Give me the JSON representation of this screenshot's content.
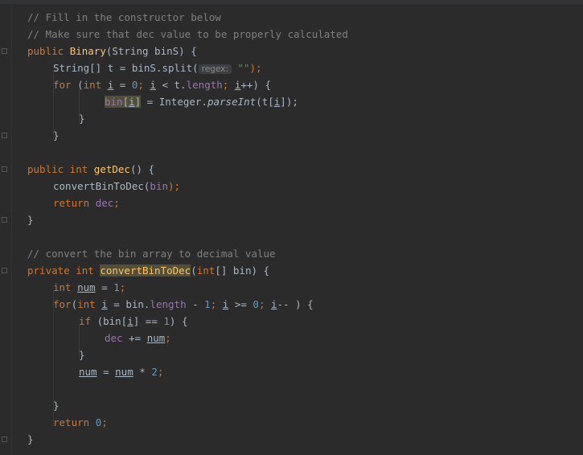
{
  "editor": {
    "lines": [
      {
        "row": 0,
        "indent": 0,
        "tokens": [
          {
            "t": "// Fill in the constructor below",
            "c": "cmt"
          }
        ]
      },
      {
        "row": 1,
        "indent": 0,
        "tokens": [
          {
            "t": "// Make sure that dec value to be properly calculated",
            "c": "cmt"
          }
        ]
      },
      {
        "row": 2,
        "indent": 0,
        "tokens": [
          {
            "t": "public ",
            "c": "kw"
          },
          {
            "t": "Binary",
            "c": "fn"
          },
          {
            "t": "(String binS) {",
            "c": ""
          }
        ]
      },
      {
        "row": 3,
        "indent": 1,
        "tokens": [
          {
            "t": "String[] t = binS.split(",
            "c": ""
          },
          {
            "t": "regex:",
            "c": "hint"
          },
          {
            "t": " ",
            "c": ""
          },
          {
            "t": "\"\"",
            "c": "str"
          },
          {
            "t": ");",
            "c": "kw"
          }
        ]
      },
      {
        "row": 4,
        "indent": 1,
        "tokens": [
          {
            "t": "for ",
            "c": "kw"
          },
          {
            "t": "(",
            "c": ""
          },
          {
            "t": "int ",
            "c": "kw"
          },
          {
            "t": "i",
            "c": "ul"
          },
          {
            "t": " = ",
            "c": ""
          },
          {
            "t": "0",
            "c": "num"
          },
          {
            "t": "; ",
            "c": "kw"
          },
          {
            "t": "i",
            "c": "ul"
          },
          {
            "t": " < t.",
            "c": ""
          },
          {
            "t": "length",
            "c": "fld"
          },
          {
            "t": "; ",
            "c": "kw"
          },
          {
            "t": "i",
            "c": "ul"
          },
          {
            "t": "++) {",
            "c": ""
          }
        ]
      },
      {
        "row": 5,
        "indent": 3,
        "tokens": [
          {
            "t": "bin",
            "c": "fld hl2"
          },
          {
            "t": "[",
            "c": "hl2"
          },
          {
            "t": "i",
            "c": "ul hl2"
          },
          {
            "t": "]",
            "c": "hl2"
          },
          {
            "t": " = Integer.",
            "c": ""
          },
          {
            "t": "parseInt",
            "c": "ital"
          },
          {
            "t": "(t[",
            "c": ""
          },
          {
            "t": "i",
            "c": "ul"
          },
          {
            "t": "]);",
            "c": ""
          }
        ]
      },
      {
        "row": 6,
        "indent": 2,
        "tokens": [
          {
            "t": "}",
            "c": ""
          }
        ]
      },
      {
        "row": 7,
        "indent": 1,
        "tokens": [
          {
            "t": "}",
            "c": ""
          }
        ]
      },
      {
        "row": 9,
        "indent": 0,
        "tokens": [
          {
            "t": "public int ",
            "c": "kw"
          },
          {
            "t": "getDec",
            "c": "fn"
          },
          {
            "t": "() {",
            "c": ""
          }
        ]
      },
      {
        "row": 10,
        "indent": 1,
        "tokens": [
          {
            "t": "convertBinToDec(",
            "c": ""
          },
          {
            "t": "bin",
            "c": "fld"
          },
          {
            "t": ");",
            "c": "kw"
          }
        ]
      },
      {
        "row": 11,
        "indent": 1,
        "tokens": [
          {
            "t": "return ",
            "c": "kw"
          },
          {
            "t": "dec",
            "c": "fld"
          },
          {
            "t": ";",
            "c": "kw"
          }
        ]
      },
      {
        "row": 12,
        "indent": 0,
        "tokens": [
          {
            "t": "}",
            "c": ""
          }
        ]
      },
      {
        "row": 14,
        "indent": 0,
        "tokens": [
          {
            "t": "// convert the bin array to decimal value",
            "c": "cmt"
          }
        ]
      },
      {
        "row": 15,
        "indent": 0,
        "tokens": [
          {
            "t": "private int ",
            "c": "kw"
          },
          {
            "t": "convertBinToDec",
            "c": "fn hl2"
          },
          {
            "t": "(",
            "c": ""
          },
          {
            "t": "int",
            "c": "kw"
          },
          {
            "t": "[] bin) {",
            "c": ""
          }
        ]
      },
      {
        "row": 16,
        "indent": 1,
        "tokens": [
          {
            "t": "int ",
            "c": "kw"
          },
          {
            "t": "num",
            "c": "ul"
          },
          {
            "t": " = ",
            "c": ""
          },
          {
            "t": "1",
            "c": "num"
          },
          {
            "t": ";",
            "c": "kw"
          }
        ]
      },
      {
        "row": 17,
        "indent": 1,
        "tokens": [
          {
            "t": "for",
            "c": "kw"
          },
          {
            "t": "(",
            "c": ""
          },
          {
            "t": "int ",
            "c": "kw"
          },
          {
            "t": "i",
            "c": "ul"
          },
          {
            "t": " = bin.",
            "c": ""
          },
          {
            "t": "length",
            "c": "fld"
          },
          {
            "t": " - ",
            "c": ""
          },
          {
            "t": "1",
            "c": "num"
          },
          {
            "t": "; ",
            "c": "kw"
          },
          {
            "t": "i",
            "c": "ul"
          },
          {
            "t": " >= ",
            "c": ""
          },
          {
            "t": "0",
            "c": "num"
          },
          {
            "t": "; ",
            "c": "kw"
          },
          {
            "t": "i",
            "c": "ul"
          },
          {
            "t": "-- ) {",
            "c": ""
          }
        ]
      },
      {
        "row": 18,
        "indent": 2,
        "tokens": [
          {
            "t": "if ",
            "c": "kw"
          },
          {
            "t": "(bin[",
            "c": ""
          },
          {
            "t": "i",
            "c": "ul"
          },
          {
            "t": "] == ",
            "c": ""
          },
          {
            "t": "1",
            "c": "num"
          },
          {
            "t": ") {",
            "c": ""
          }
        ]
      },
      {
        "row": 19,
        "indent": 3,
        "tokens": [
          {
            "t": "dec",
            "c": "fld"
          },
          {
            "t": " += ",
            "c": ""
          },
          {
            "t": "num",
            "c": "ul"
          },
          {
            "t": ";",
            "c": "kw"
          }
        ]
      },
      {
        "row": 20,
        "indent": 2,
        "tokens": [
          {
            "t": "}",
            "c": ""
          }
        ]
      },
      {
        "row": 21,
        "indent": 2,
        "tokens": [
          {
            "t": "num",
            "c": "ul"
          },
          {
            "t": " = ",
            "c": ""
          },
          {
            "t": "num",
            "c": "ul"
          },
          {
            "t": " * ",
            "c": ""
          },
          {
            "t": "2",
            "c": "num"
          },
          {
            "t": ";",
            "c": "kw"
          }
        ]
      },
      {
        "row": 23,
        "indent": 1,
        "tokens": [
          {
            "t": "}",
            "c": ""
          }
        ]
      },
      {
        "row": 24,
        "indent": 1,
        "tokens": [
          {
            "t": "return ",
            "c": "kw"
          },
          {
            "t": "0",
            "c": "num"
          },
          {
            "t": ";",
            "c": "kw"
          }
        ]
      },
      {
        "row": 25,
        "indent": 0,
        "tokens": [
          {
            "t": "}",
            "c": ""
          }
        ]
      }
    ]
  },
  "theme": {
    "background": "#2b2b2b",
    "keyword": "#cc7832",
    "method": "#ffc66d",
    "field": "#9876aa",
    "number": "#6897bb",
    "string": "#6a8759",
    "comment": "#808080",
    "text": "#a9b7c6"
  }
}
